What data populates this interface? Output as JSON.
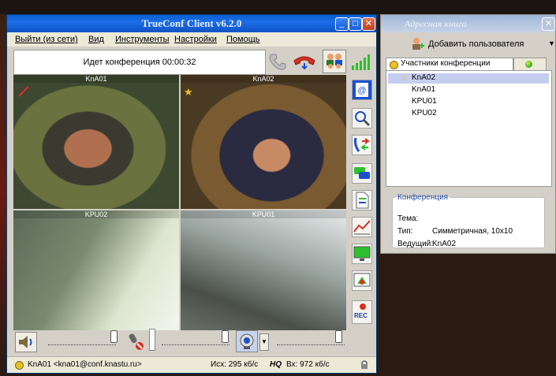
{
  "main_window": {
    "title": "TrueConf Client v6.2.0",
    "menu": [
      "Выйти (из сети)",
      "Вид",
      "Инструменты",
      "Настройки",
      "Помощь"
    ],
    "conference_status": "Идет конференция 00:00:32",
    "videos": [
      {
        "label": "KnA01"
      },
      {
        "label": "KnA02"
      },
      {
        "label": "KPU02"
      },
      {
        "label": "KPU01"
      }
    ],
    "status_bar": {
      "user": "KnA01 <kna01@conf.knastu.ru>",
      "out_rate": "Исх: 295 кб/с",
      "quality": "HQ",
      "in_rate": "Вх: 972 кб/с"
    },
    "rec_label": "REC"
  },
  "address_book": {
    "title": "Адресная книга",
    "add_user": "Добавить пользователя",
    "tab_participants": "Участники конференции",
    "participants": [
      "KnA02",
      "KnA01",
      "KPU01",
      "KPU02"
    ],
    "conference_legend": "Конференция",
    "theme_label": "Тема:",
    "type_label": "Тип:",
    "type_value": "Симметричная, 10x10",
    "host_label": "Ведущий:",
    "host_value": "KnA02"
  },
  "colors": {
    "title_blue": "#0e53c1",
    "accent_green": "#2fbf2f",
    "hangup_red": "#d83020"
  }
}
